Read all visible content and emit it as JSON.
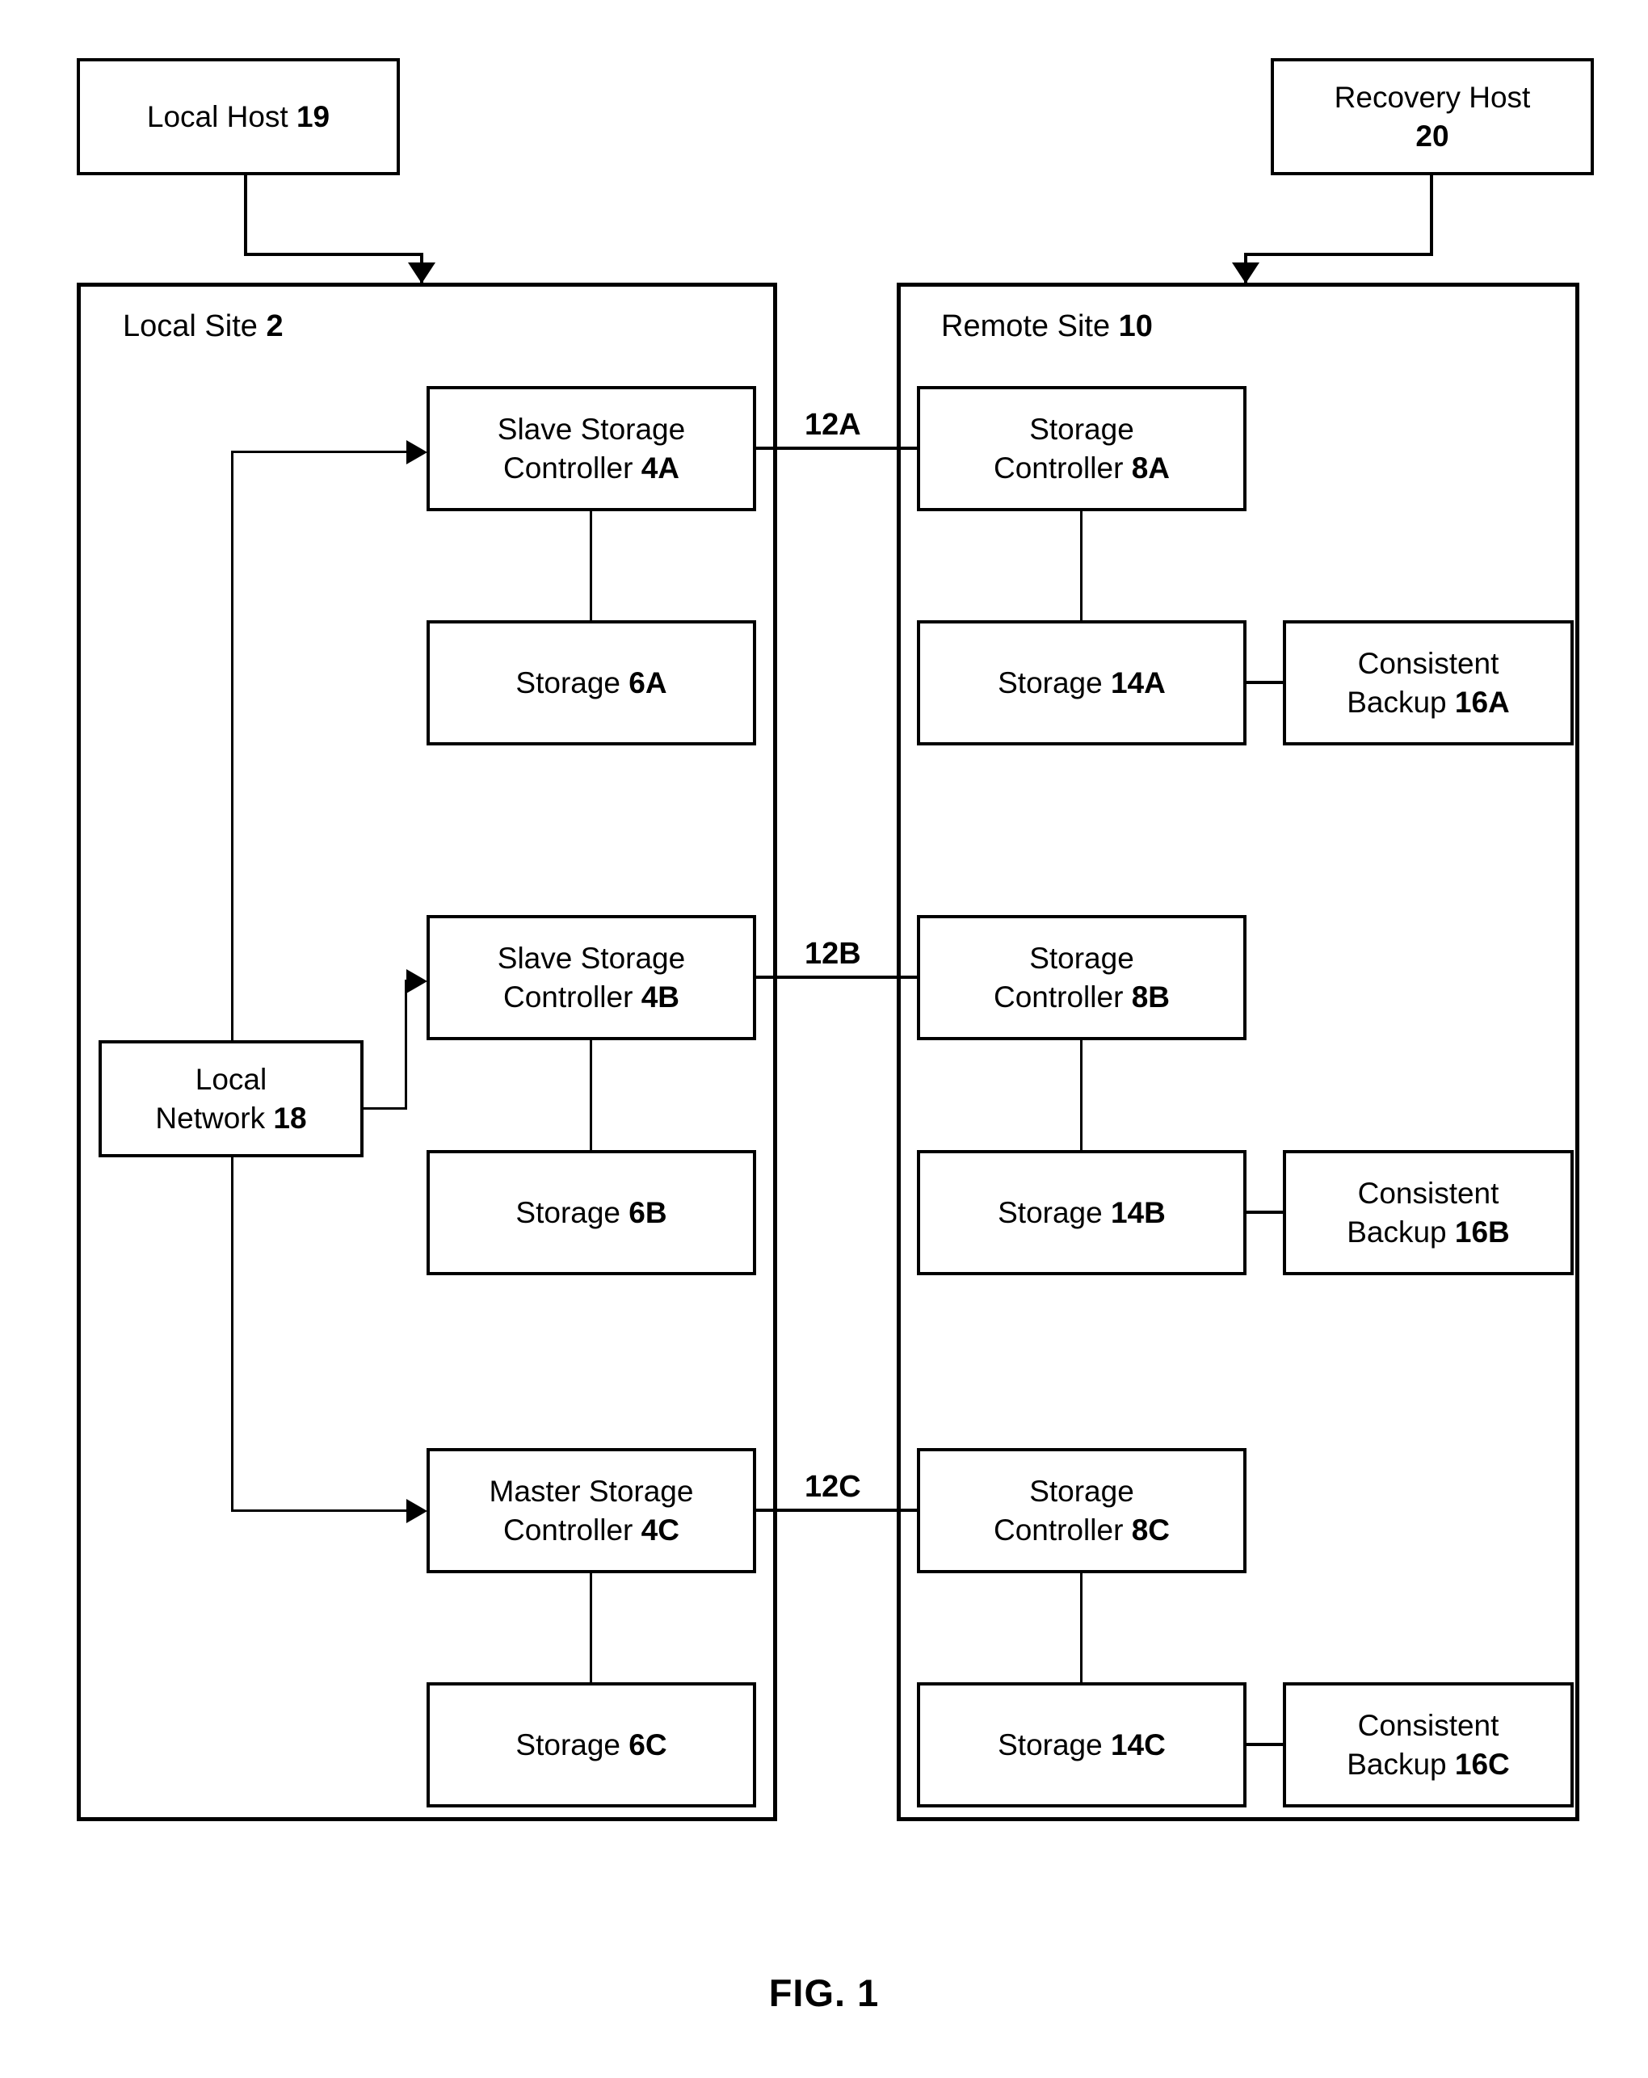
{
  "figure": {
    "caption": "FIG. 1"
  },
  "hosts": {
    "local_host": {
      "text": "Local Host 19",
      "name": "Local Host",
      "ref": "19"
    },
    "recovery_host": {
      "text": "Recovery Host\n20",
      "name": "Recovery Host",
      "ref": "20"
    }
  },
  "sites": {
    "local": {
      "label": "Local Site 2",
      "name": "Local Site",
      "ref": "2"
    },
    "remote": {
      "label": "Remote Site 10",
      "name": "Remote Site",
      "ref": "10"
    }
  },
  "local_network": {
    "text": "Local\nNetwork 18",
    "name": "Local Network",
    "ref": "18"
  },
  "rows": [
    {
      "local_controller": "Slave Storage\nController 4A",
      "local_storage": "Storage 6A",
      "link_label": "12A",
      "remote_controller": "Storage\nController 8A",
      "remote_storage": "Storage 14A",
      "backup": "Consistent\nBackup 16A"
    },
    {
      "local_controller": "Slave Storage\nController 4B",
      "local_storage": "Storage 6B",
      "link_label": "12B",
      "remote_controller": "Storage\nController 8B",
      "remote_storage": "Storage 14B",
      "backup": "Consistent\nBackup 16B"
    },
    {
      "local_controller": "Master Storage\nController 4C",
      "local_storage": "Storage 6C",
      "link_label": "12C",
      "remote_controller": "Storage\nController 8C",
      "remote_storage": "Storage 14C",
      "backup": "Consistent\nBackup 16C"
    }
  ],
  "colors": {
    "stroke": "#000000",
    "background": "#ffffff"
  }
}
